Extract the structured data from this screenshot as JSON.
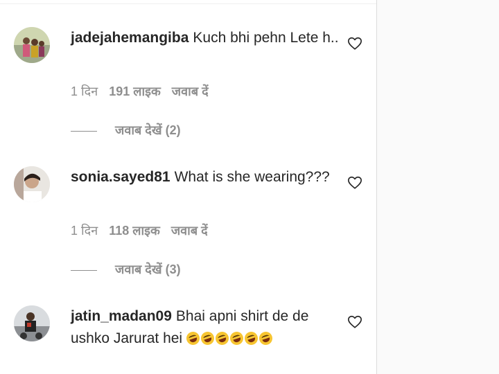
{
  "comments": [
    {
      "username": "jadejahemangiba",
      "text": "Kuch bhi pehn Lete h..",
      "time": "1 दिन",
      "likes": "191 लाइक",
      "reply_label": "जवाब दें",
      "view_replies": "जवाब देखें (2)",
      "emoji_count": 0
    },
    {
      "username": "sonia.sayed81",
      "text": "What is she wearing???",
      "time": "1 दिन",
      "likes": "118 लाइक",
      "reply_label": "जवाब दें",
      "view_replies": "जवाब देखें (3)",
      "emoji_count": 0
    },
    {
      "username": "jatin_madan09",
      "text": "Bhai apni shirt de de ushko Jarurat hei",
      "emoji": "🤣",
      "emoji_count": 6
    }
  ],
  "colors": {
    "text": "#262626",
    "secondary": "#8e8e8e",
    "border": "#dbdbdb",
    "sidebar_bg": "#fafafa"
  },
  "icons": {
    "like": "heart-outline-icon"
  }
}
